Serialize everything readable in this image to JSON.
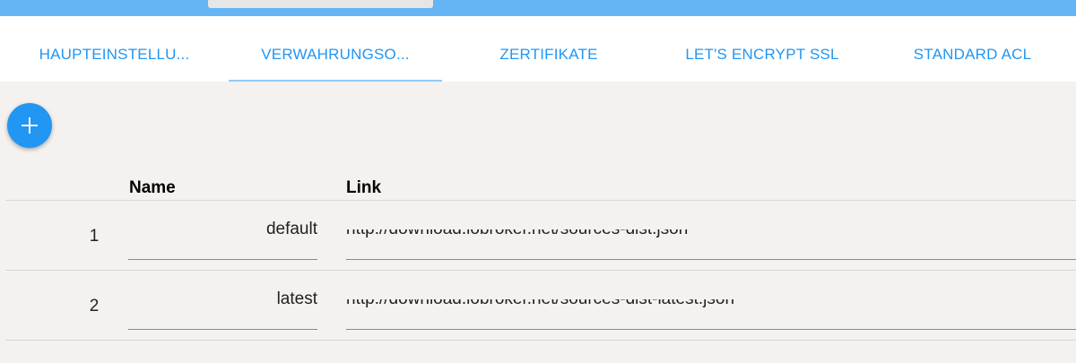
{
  "tabs": [
    {
      "label": "HAUPTEINSTELLU..."
    },
    {
      "label": "VERWAHRUNGSO..."
    },
    {
      "label": "ZERTIFIKATE"
    },
    {
      "label": "LET'S ENCRYPT SSL"
    },
    {
      "label": "STANDARD ACL"
    }
  ],
  "active_tab": "VERWAHRUNGSO...",
  "table": {
    "headers": {
      "name": "Name",
      "link": "Link"
    },
    "rows": [
      {
        "index": "1",
        "name": "default",
        "link": "http://download.iobroker.net/sources-dist.json"
      },
      {
        "index": "2",
        "name": "latest",
        "link": "http://download.iobroker.net/sources-dist-latest.json"
      }
    ]
  },
  "icons": {
    "add": "plus-icon"
  },
  "colors": {
    "accent": "#2196f3",
    "topbar": "#64b5f6",
    "background": "#f4f1ee"
  }
}
